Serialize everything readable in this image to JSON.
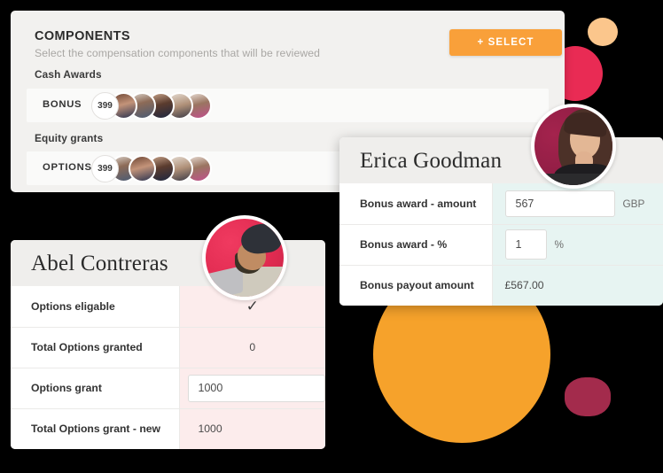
{
  "components_panel": {
    "title": "COMPONENTS",
    "subtitle": "Select the compensation components that will be reviewed",
    "select_button": "+ SELECT",
    "groups": [
      {
        "label": "Cash Awards",
        "row_name": "BONUS",
        "stack_count": "399"
      },
      {
        "label": "Equity grants",
        "row_name": "OPTIONS",
        "stack_count": "399"
      }
    ]
  },
  "erica_card": {
    "name": "Erica Goodman",
    "rows": [
      {
        "label": "Bonus award - amount",
        "value": "567",
        "unit": "GBP",
        "type": "input"
      },
      {
        "label": "Bonus award - %",
        "value": "1",
        "unit": "%",
        "type": "input"
      },
      {
        "label": "Bonus payout amount",
        "value": "£567.00",
        "unit": "",
        "type": "text"
      }
    ]
  },
  "abel_card": {
    "name": "Abel Contreras",
    "rows": [
      {
        "label": "Options eligable",
        "value": "✓",
        "type": "check"
      },
      {
        "label": "Total Options granted",
        "value": "0",
        "type": "text-centered"
      },
      {
        "label": "Options grant",
        "value": "1000",
        "type": "input"
      },
      {
        "label": "Total Options grant - new",
        "value": "1000",
        "type": "text"
      }
    ]
  },
  "colors": {
    "accent_orange": "#F9A03A",
    "crimson": "#E92B54",
    "peach": "#FBC68C",
    "maroon": "#A32B4C",
    "mint_cell": "#E7F4F2",
    "pink_cell": "#FCECEC"
  }
}
